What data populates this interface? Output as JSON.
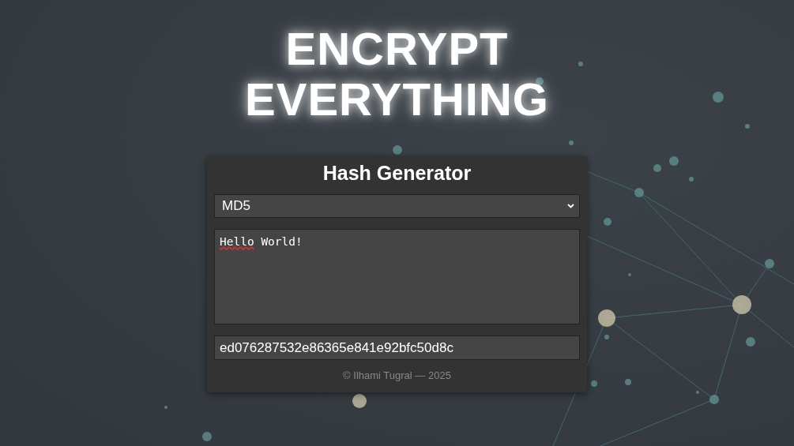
{
  "headline": [
    "ENCRYPT",
    "EVERYTHING"
  ],
  "card": {
    "title": "Hash Generator",
    "algorithm_select": {
      "value": "MD5"
    },
    "input_text": {
      "value": "Hello World!"
    },
    "hash_output": {
      "value": "ed076287532e86365e841e92bfc50d8c"
    },
    "footer": "© Ilhami Tugral — 2025"
  }
}
